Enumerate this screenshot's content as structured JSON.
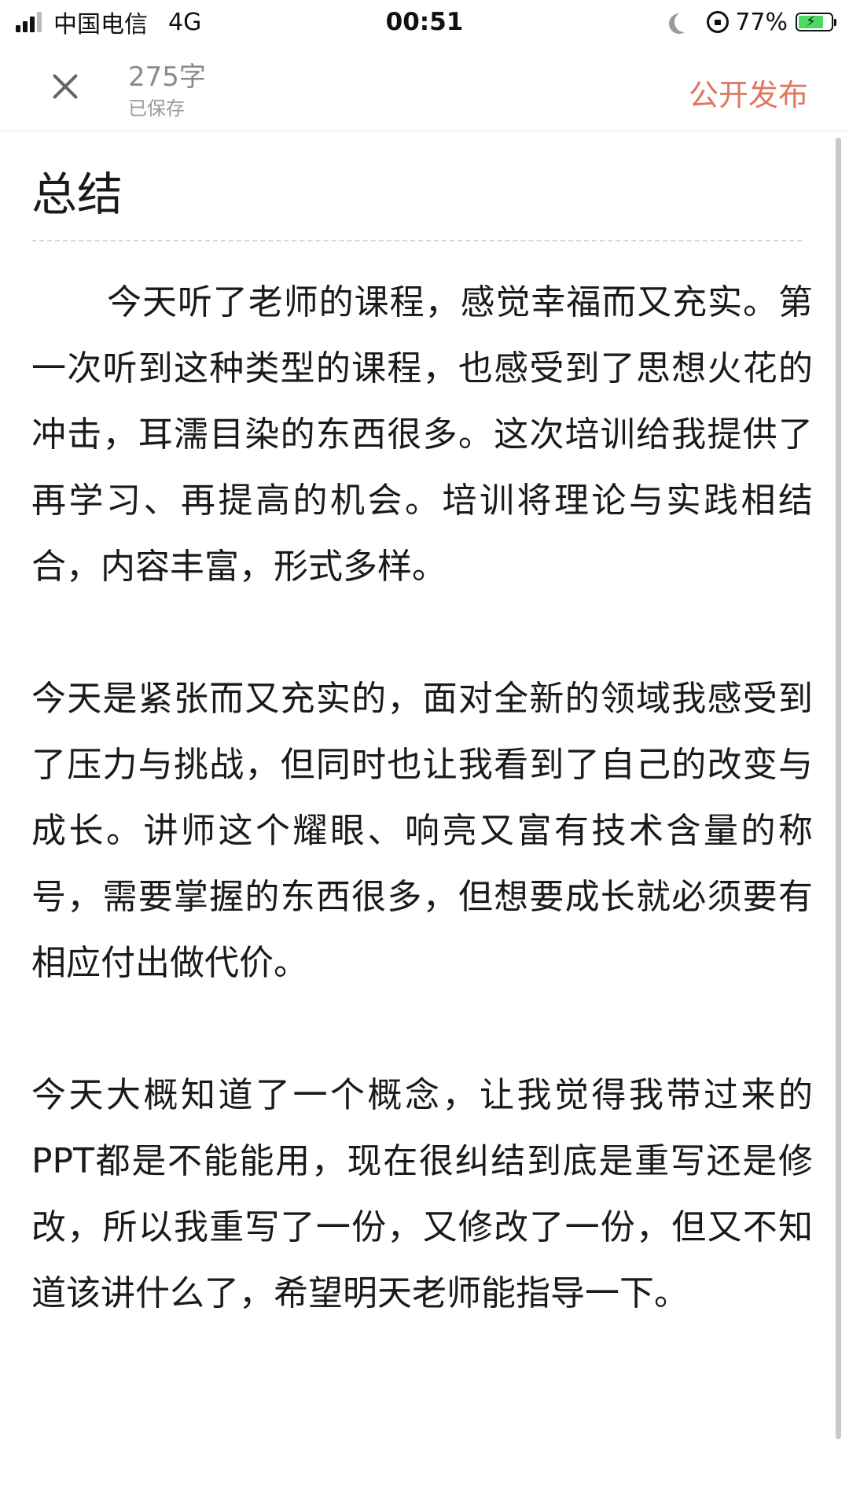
{
  "status_bar": {
    "carrier": "中国电信",
    "network": "4G",
    "time": "00:51",
    "battery_percent": "77%",
    "battery_level": 0.77,
    "battery_color": "#4cd964"
  },
  "toolbar": {
    "word_count": "275字",
    "save_status": "已保存",
    "publish_label": "公开发布",
    "accent_color": "#e0765d",
    "close_icon": "close-icon"
  },
  "document": {
    "title": "总结",
    "paragraphs": [
      "今天听了老师的课程，感觉幸福而又充实。第一次听到这种类型的课程，也感受到了思想火花的冲击，耳濡目染的东西很多。这次培训给我提供了再学习、再提高的机会。培训将理论与实践相结合，内容丰富，形式多样。",
      "今天是紧张而又充实的，面对全新的领域我感受到了压力与挑战，但同时也让我看到了自己的改变与成长。讲师这个耀眼、响亮又富有技术含量的称号，需要掌握的东西很多，但想要成长就必须要有相应付出做代价。",
      "今天大概知道了一个概念，让我觉得我带过来的PPT都是不能能用，现在很纠结到底是重写还是修改，所以我重写了一份，又修改了一份，但又不知道该讲什么了，希望明天老师能指导一下。"
    ]
  }
}
